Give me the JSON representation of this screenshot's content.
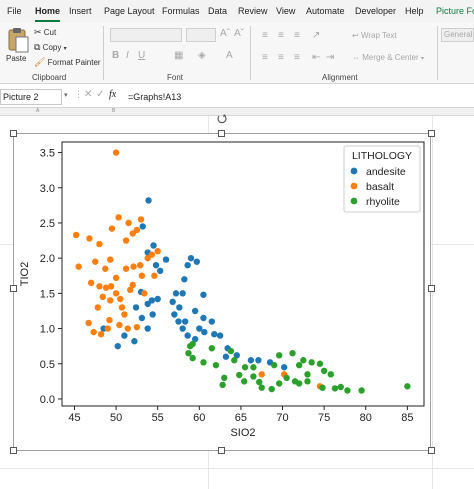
{
  "ribbon_tabs": [
    "File",
    "Home",
    "Insert",
    "Page Layout",
    "Formulas",
    "Data",
    "Review",
    "View",
    "Automate",
    "Developer",
    "Help",
    "Picture Fo"
  ],
  "active_tab": "Home",
  "clipboard": {
    "paste_label": "Paste",
    "cut_label": "Cut",
    "copy_label": "Copy",
    "format_painter_label": "Format Painter",
    "group_label": "Clipboard"
  },
  "font_group": {
    "group_label": "Font"
  },
  "alignment_group": {
    "wrap_text_label": "Wrap Text",
    "merge_center_label": "Merge & Center",
    "group_label": "Alignment"
  },
  "number_group": {
    "format_value": "General"
  },
  "formula_bar": {
    "name_box": "Picture 2",
    "fx_label": "fx",
    "formula": "=Graphs!A13"
  },
  "colors": {
    "accent": "#107c41",
    "andesite": "#1f77b4",
    "basalt": "#ff7f0e",
    "rhyolite": "#2ca02c"
  },
  "chart_data": {
    "type": "scatter",
    "xlabel": "SIO2",
    "ylabel": "TIO2",
    "xlim": [
      43.5,
      87
    ],
    "ylim": [
      -0.1,
      3.65
    ],
    "x_ticks": [
      45,
      50,
      55,
      60,
      65,
      70,
      75,
      80,
      85
    ],
    "y_ticks": [
      0.0,
      0.5,
      1.0,
      1.5,
      2.0,
      2.5,
      3.0,
      3.5
    ],
    "grid": false,
    "legend": {
      "title": "LITHOLOGY",
      "placement": "top-right"
    },
    "series": [
      {
        "name": "andesite",
        "color": "#1f77b4",
        "points": [
          [
            53.9,
            2.82
          ],
          [
            53.2,
            2.45
          ],
          [
            54.5,
            2.18
          ],
          [
            53.8,
            2.08
          ],
          [
            56.0,
            1.98
          ],
          [
            54.8,
            1.9
          ],
          [
            55.3,
            1.82
          ],
          [
            59.0,
            2.0
          ],
          [
            59.7,
            1.95
          ],
          [
            58.6,
            1.9
          ],
          [
            58.2,
            1.7
          ],
          [
            57.2,
            1.5
          ],
          [
            58.0,
            1.5
          ],
          [
            60.5,
            1.48
          ],
          [
            53.0,
            1.52
          ],
          [
            53.8,
            1.35
          ],
          [
            54.3,
            1.4
          ],
          [
            55.0,
            1.42
          ],
          [
            56.8,
            1.38
          ],
          [
            57.6,
            1.3
          ],
          [
            57.0,
            1.2
          ],
          [
            58.3,
            1.1
          ],
          [
            59.5,
            1.25
          ],
          [
            60.5,
            1.15
          ],
          [
            61.5,
            1.1
          ],
          [
            52.4,
            1.3
          ],
          [
            53.1,
            1.15
          ],
          [
            54.4,
            1.2
          ],
          [
            57.5,
            1.1
          ],
          [
            58.0,
            1.0
          ],
          [
            58.6,
            0.9
          ],
          [
            59.5,
            0.85
          ],
          [
            60.0,
            1.0
          ],
          [
            60.6,
            0.95
          ],
          [
            61.8,
            0.92
          ],
          [
            62.5,
            0.9
          ],
          [
            63.4,
            0.72
          ],
          [
            63.2,
            0.6
          ],
          [
            64.5,
            0.62
          ],
          [
            66.2,
            0.55
          ],
          [
            67.1,
            0.55
          ],
          [
            68.5,
            0.52
          ],
          [
            70.2,
            0.45
          ],
          [
            48.5,
            1.0
          ],
          [
            51.0,
            0.9
          ],
          [
            53.8,
            1.0
          ],
          [
            50.2,
            0.75
          ],
          [
            52.2,
            0.82
          ]
        ]
      },
      {
        "name": "basalt",
        "color": "#ff7f0e",
        "points": [
          [
            50.0,
            3.5
          ],
          [
            50.3,
            2.58
          ],
          [
            49.5,
            2.42
          ],
          [
            51.5,
            2.5
          ],
          [
            52.5,
            2.4
          ],
          [
            53.0,
            2.55
          ],
          [
            52.0,
            2.35
          ],
          [
            51.2,
            2.25
          ],
          [
            45.2,
            2.33
          ],
          [
            46.8,
            2.28
          ],
          [
            48.0,
            2.2
          ],
          [
            54.3,
            2.05
          ],
          [
            55.0,
            2.1
          ],
          [
            53.8,
            2.0
          ],
          [
            47.5,
            1.95
          ],
          [
            49.3,
            1.98
          ],
          [
            48.7,
            1.85
          ],
          [
            45.5,
            1.88
          ],
          [
            47.0,
            1.65
          ],
          [
            51.2,
            1.85
          ],
          [
            52.1,
            1.88
          ],
          [
            52.9,
            1.9
          ],
          [
            53.1,
            1.75
          ],
          [
            54.6,
            1.75
          ],
          [
            52.0,
            1.62
          ],
          [
            50.0,
            1.72
          ],
          [
            48.0,
            1.6
          ],
          [
            48.8,
            1.58
          ],
          [
            49.4,
            1.6
          ],
          [
            51.7,
            1.55
          ],
          [
            53.4,
            1.5
          ],
          [
            48.4,
            1.45
          ],
          [
            49.3,
            1.4
          ],
          [
            50.0,
            1.5
          ],
          [
            50.5,
            1.42
          ],
          [
            47.8,
            1.3
          ],
          [
            49.2,
            1.12
          ],
          [
            50.7,
            1.3
          ],
          [
            51.0,
            1.2
          ],
          [
            46.7,
            1.08
          ],
          [
            49.0,
            1.0
          ],
          [
            50.4,
            1.05
          ],
          [
            51.4,
            1.0
          ],
          [
            52.5,
            1.02
          ],
          [
            47.3,
            0.95
          ],
          [
            48.2,
            0.92
          ],
          [
            67.5,
            0.35
          ],
          [
            70.2,
            0.35
          ],
          [
            74.5,
            0.18
          ]
        ]
      },
      {
        "name": "rhyolite",
        "color": "#2ca02c",
        "points": [
          [
            59.2,
            0.78
          ],
          [
            61.5,
            0.72
          ],
          [
            64.2,
            0.55
          ],
          [
            63.8,
            0.68
          ],
          [
            65.5,
            0.45
          ],
          [
            66.5,
            0.45
          ],
          [
            69.0,
            0.48
          ],
          [
            69.6,
            0.62
          ],
          [
            71.2,
            0.65
          ],
          [
            72.0,
            0.48
          ],
          [
            72.5,
            0.55
          ],
          [
            73.5,
            0.52
          ],
          [
            74.5,
            0.5
          ],
          [
            75.0,
            0.4
          ],
          [
            75.8,
            0.35
          ],
          [
            73.0,
            0.35
          ],
          [
            70.5,
            0.3
          ],
          [
            71.5,
            0.25
          ],
          [
            72.0,
            0.22
          ],
          [
            69.6,
            0.22
          ],
          [
            67.2,
            0.24
          ],
          [
            67.5,
            0.16
          ],
          [
            68.7,
            0.14
          ],
          [
            66.5,
            0.32
          ],
          [
            64.8,
            0.34
          ],
          [
            63.0,
            0.3
          ],
          [
            62.0,
            0.48
          ],
          [
            60.5,
            0.52
          ],
          [
            59.2,
            0.58
          ],
          [
            58.7,
            0.65
          ],
          [
            58.9,
            0.75
          ],
          [
            76.3,
            0.15
          ],
          [
            77.0,
            0.17
          ],
          [
            77.8,
            0.12
          ],
          [
            79.5,
            0.12
          ],
          [
            85.0,
            0.18
          ],
          [
            73.0,
            0.25
          ],
          [
            74.8,
            0.16
          ],
          [
            62.8,
            0.2
          ],
          [
            65.4,
            0.25
          ]
        ]
      }
    ]
  }
}
